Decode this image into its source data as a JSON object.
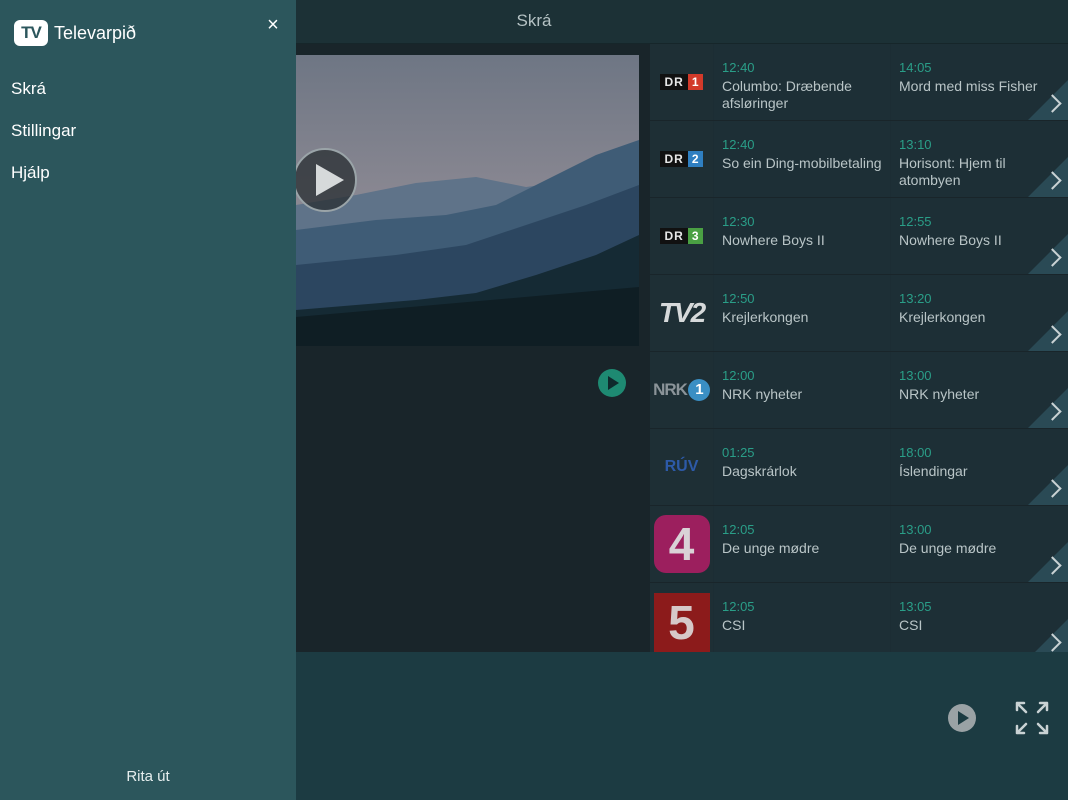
{
  "header": {
    "title": "Skrá"
  },
  "drawer": {
    "brand_mark": "TV",
    "brand_name": "Televarpið",
    "close_label": "×",
    "items": [
      {
        "label": "Skrá"
      },
      {
        "label": "Stillingar"
      },
      {
        "label": "Hjálp"
      }
    ],
    "logout_label": "Rita út"
  },
  "channels": [
    {
      "logo": {
        "text": "DR",
        "num": "1",
        "color": "#d23a2a"
      },
      "now": {
        "time": "12:40",
        "title": "Columbo: Dræbende afsløringer"
      },
      "next": {
        "time": "14:05",
        "title": "Mord med miss Fisher"
      }
    },
    {
      "logo": {
        "text": "DR",
        "num": "2",
        "color": "#2f7fc1"
      },
      "now": {
        "time": "12:40",
        "title": "So ein Ding-mobilbetaling"
      },
      "next": {
        "time": "13:10",
        "title": "Horisont: Hjem til atombyen"
      }
    },
    {
      "logo": {
        "text": "DR",
        "num": "3",
        "color": "#4aa043"
      },
      "now": {
        "time": "12:30",
        "title": "Nowhere Boys II"
      },
      "next": {
        "time": "12:55",
        "title": "Nowhere Boys II"
      }
    },
    {
      "logo": {
        "text": "TV2"
      },
      "now": {
        "time": "12:50",
        "title": "Krejlerkongen"
      },
      "next": {
        "time": "13:20",
        "title": "Krejlerkongen"
      }
    },
    {
      "logo": {
        "text": "NRK",
        "num": "1"
      },
      "now": {
        "time": "12:00",
        "title": "NRK nyheter"
      },
      "next": {
        "time": "13:00",
        "title": "NRK nyheter"
      }
    },
    {
      "logo": {
        "text": "RÚV"
      },
      "now": {
        "time": "01:25",
        "title": "Dagskrárlok"
      },
      "next": {
        "time": "18:00",
        "title": "Íslendingar"
      }
    },
    {
      "logo": {
        "text": "4"
      },
      "now": {
        "time": "12:05",
        "title": "De unge mødre"
      },
      "next": {
        "time": "13:00",
        "title": "De unge mødre"
      }
    },
    {
      "logo": {
        "text": "5"
      },
      "now": {
        "time": "12:05",
        "title": "CSI"
      },
      "next": {
        "time": "13:05",
        "title": "CSI"
      }
    }
  ],
  "colors": {
    "accent": "#2a9e88",
    "drawer": "#2c565c"
  }
}
